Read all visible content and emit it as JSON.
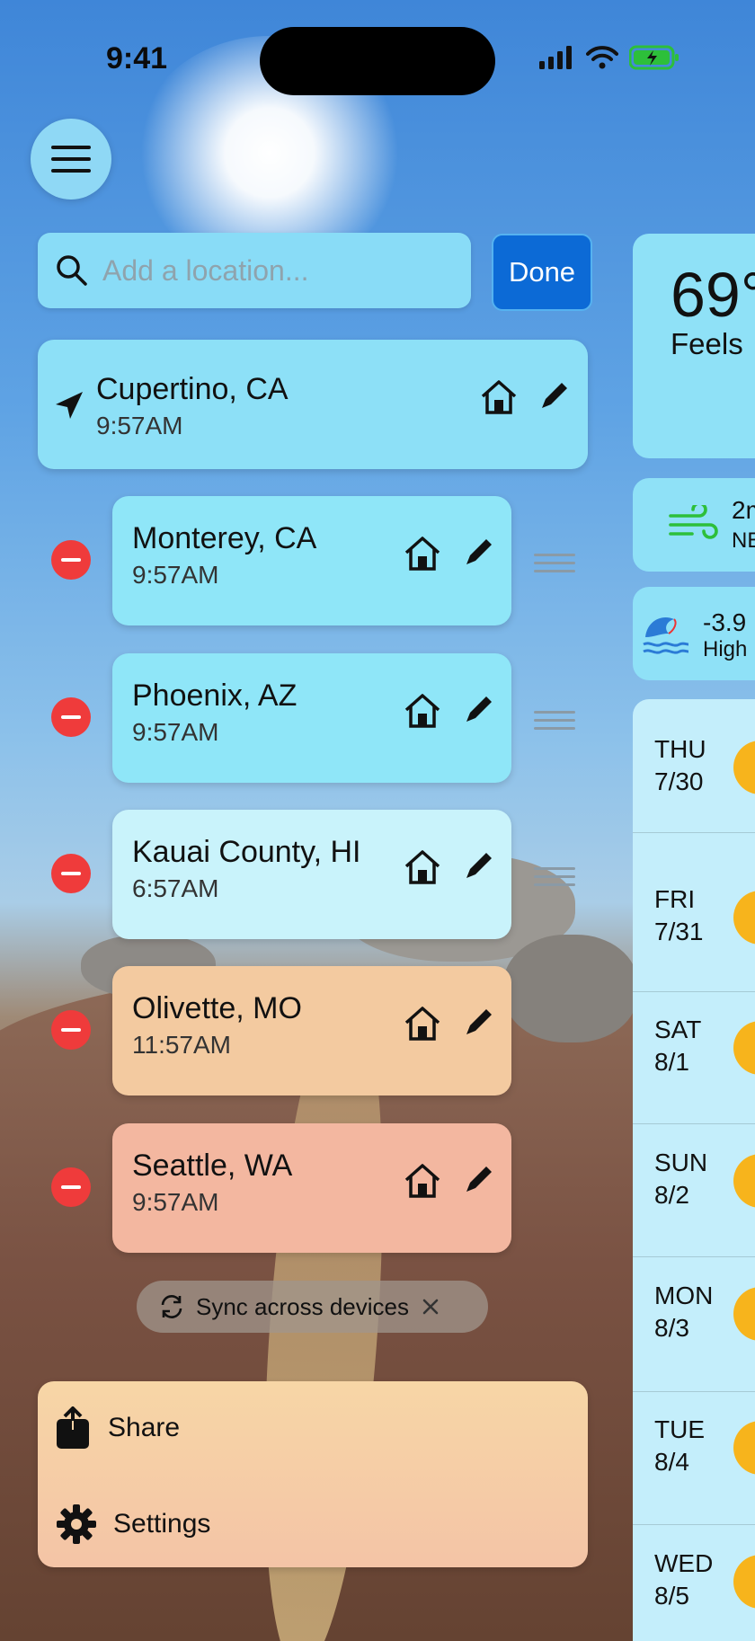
{
  "status_bar": {
    "time": "9:41"
  },
  "search": {
    "placeholder": "Add a location...",
    "done_label": "Done"
  },
  "current_location": {
    "name": "Cupertino, CA",
    "time": "9:57AM"
  },
  "locations": [
    {
      "name": "Monterey, CA",
      "time": "9:57AM"
    },
    {
      "name": "Phoenix, AZ",
      "time": "9:57AM"
    },
    {
      "name": "Kauai County, HI",
      "time": "6:57AM"
    },
    {
      "name": "Olivette, MO",
      "time": "11:57AM"
    },
    {
      "name": "Seattle, WA",
      "time": "9:57AM"
    }
  ],
  "sync": {
    "label": "Sync across devices"
  },
  "menu": {
    "share_label": "Share",
    "settings_label": "Settings"
  },
  "weather": {
    "temperature": "69°",
    "feels": "Feels",
    "wind_value": "2m",
    "wind_dir": "NE",
    "tide_value": "-3.9",
    "tide_label": "High"
  },
  "forecast": [
    {
      "day": "THU",
      "date": "7/30"
    },
    {
      "day": "FRI",
      "date": "7/31"
    },
    {
      "day": "SAT",
      "date": "8/1"
    },
    {
      "day": "SUN",
      "date": "8/2"
    },
    {
      "day": "MON",
      "date": "8/3"
    },
    {
      "day": "TUE",
      "date": "8/4"
    },
    {
      "day": "WED",
      "date": "8/5"
    }
  ],
  "colors": {
    "accent": "#0c6ad6",
    "delete": "#ef3b3b",
    "card": "#8fe6f8"
  }
}
